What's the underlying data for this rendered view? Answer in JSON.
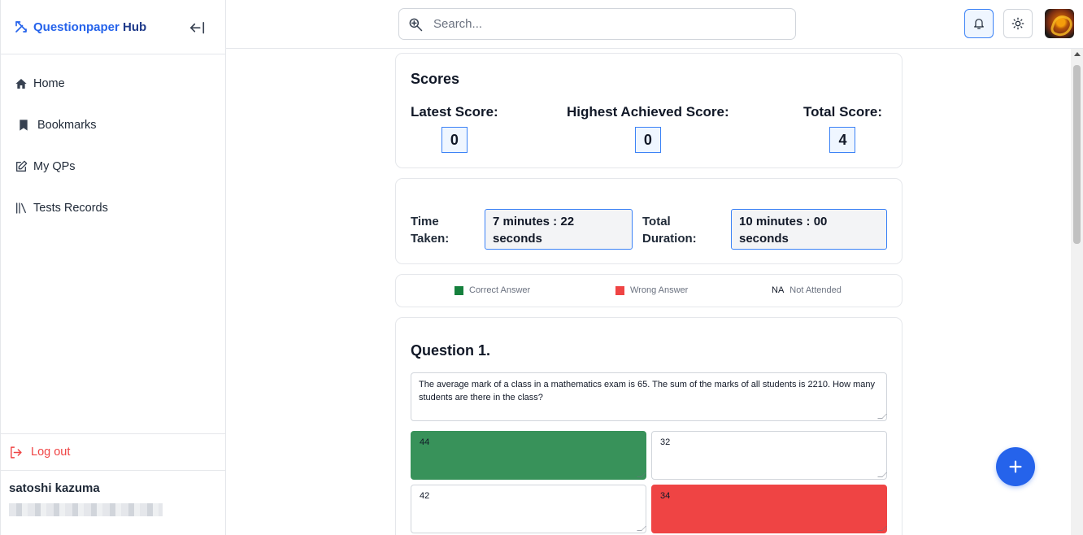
{
  "brand": {
    "name_part1": "Questionpaper",
    "name_part2": " Hub"
  },
  "sidebar": {
    "items": [
      {
        "label": "Home",
        "icon": "home-icon"
      },
      {
        "label": "Bookmarks",
        "icon": "bookmark-icon"
      },
      {
        "label": "My QPs",
        "icon": "edit-icon"
      },
      {
        "label": "Tests Records",
        "icon": "library-icon"
      }
    ],
    "logout_label": "Log out"
  },
  "user": {
    "name": "satoshi kazuma"
  },
  "search": {
    "placeholder": "Search..."
  },
  "scores": {
    "title": "Scores",
    "latest_label": "Latest Score:",
    "latest_value": "0",
    "highest_label": "Highest Achieved Score:",
    "highest_value": "0",
    "total_label": "Total Score:",
    "total_value": "4"
  },
  "time": {
    "taken_label_line1": "Time",
    "taken_label_line2": "Taken:",
    "taken_value_line1": "7 minutes : 22",
    "taken_value_line2": "seconds",
    "duration_label_line1": "Total",
    "duration_label_line2": "Duration:",
    "duration_value_line1": "10 minutes : 00",
    "duration_value_line2": "seconds"
  },
  "legend": {
    "correct": "Correct Answer",
    "wrong": "Wrong Answer",
    "na_marker": "NA",
    "not_attended": "Not Attended",
    "correct_color": "#15803d",
    "wrong_color": "#ef4444"
  },
  "question": {
    "title": "Question 1.",
    "text": "The average mark of a class in a mathematics exam is 65. The sum of the marks of all students is 2210. How many students are there in the class?",
    "options": [
      "44",
      "32",
      "42",
      "34"
    ]
  },
  "colors": {
    "accent": "#2563eb",
    "correct_option": "#38925a",
    "wrong_option": "#ef4444",
    "logout": "#ef4444"
  }
}
